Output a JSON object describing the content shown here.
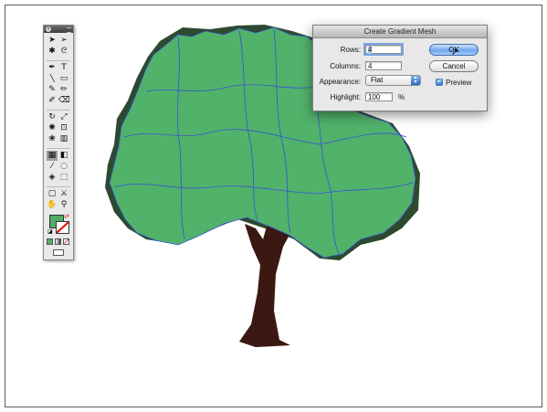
{
  "toolbox": {
    "tools": [
      {
        "name": "selection-tool-icon",
        "glyph": "➤"
      },
      {
        "name": "direct-selection-tool-icon",
        "glyph": "➢"
      },
      {
        "name": "magic-wand-tool-icon",
        "glyph": "✱"
      },
      {
        "name": "lasso-tool-icon",
        "glyph": "ᘓ"
      },
      {
        "name": "pen-tool-icon",
        "glyph": "✒"
      },
      {
        "name": "type-tool-icon",
        "glyph": "T"
      },
      {
        "name": "line-tool-icon",
        "glyph": "╲"
      },
      {
        "name": "rectangle-tool-icon",
        "glyph": "▭"
      },
      {
        "name": "paintbrush-tool-icon",
        "glyph": "✎"
      },
      {
        "name": "pencil-tool-icon",
        "glyph": "✏"
      },
      {
        "name": "blob-brush-tool-icon",
        "glyph": "✐"
      },
      {
        "name": "eraser-tool-icon",
        "glyph": "⌫"
      },
      {
        "name": "rotate-tool-icon",
        "glyph": "↻"
      },
      {
        "name": "scale-tool-icon",
        "glyph": "⤢"
      },
      {
        "name": "warp-tool-icon",
        "glyph": "✺"
      },
      {
        "name": "free-transform-tool-icon",
        "glyph": "⊡"
      },
      {
        "name": "symbol-sprayer-tool-icon",
        "glyph": "❀"
      },
      {
        "name": "column-graph-tool-icon",
        "glyph": "▥"
      },
      {
        "name": "mesh-tool-icon",
        "glyph": "▦"
      },
      {
        "name": "gradient-tool-icon",
        "glyph": "◧"
      },
      {
        "name": "eyedropper-tool-icon",
        "glyph": "⁄"
      },
      {
        "name": "blend-tool-icon",
        "glyph": "◌"
      },
      {
        "name": "live-paint-bucket-tool-icon",
        "glyph": "◈"
      },
      {
        "name": "live-paint-selection-tool-icon",
        "glyph": "⬚"
      },
      {
        "name": "artboard-tool-icon",
        "glyph": "▢"
      },
      {
        "name": "slice-tool-icon",
        "glyph": "⚔"
      },
      {
        "name": "hand-tool-icon",
        "glyph": "✋"
      },
      {
        "name": "zoom-tool-icon",
        "glyph": "⚲"
      }
    ],
    "fill_color": "#4fae63",
    "stroke_color": "none"
  },
  "dialog": {
    "title": "Create Gradient Mesh",
    "rows_label": "Rows:",
    "rows_value": "4",
    "columns_label": "Columns:",
    "columns_value": "4",
    "appearance_label": "Appearance:",
    "appearance_value": "Flat",
    "highlight_label": "Highlight:",
    "highlight_value": "100",
    "highlight_unit": "%",
    "ok_label": "OK",
    "cancel_label": "Cancel",
    "preview_label": "Preview",
    "preview_checked": true
  },
  "artwork": {
    "foliage_color": "#51b26a",
    "foliage_shadow_color": "#2d4a2f",
    "mesh_line_color": "#3a52d4",
    "trunk_color": "#3b1811"
  }
}
